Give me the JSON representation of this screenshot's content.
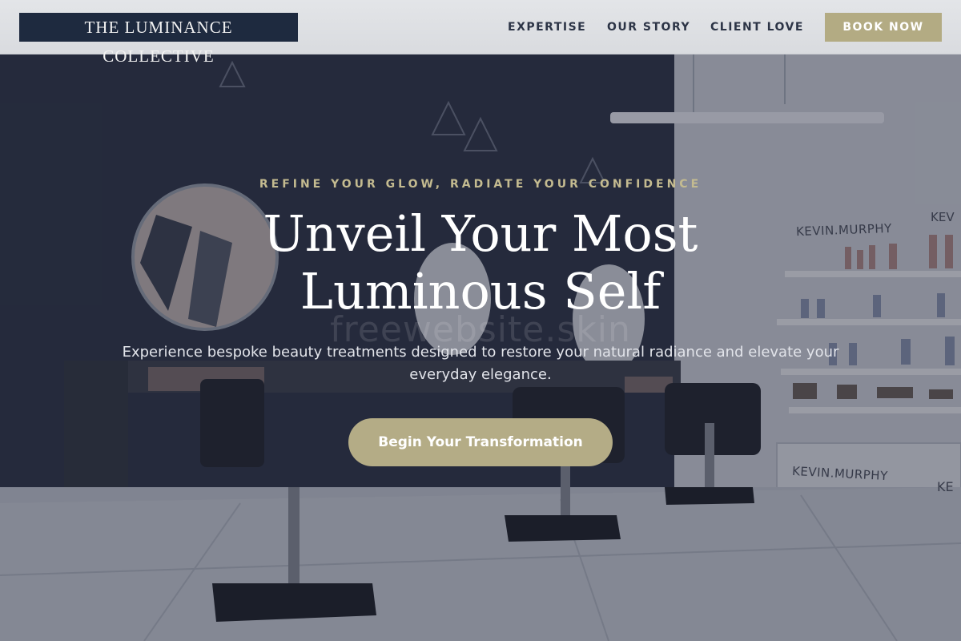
{
  "brand": {
    "name": "THE LUMINANCE COLLECTIVE"
  },
  "nav": {
    "items": [
      {
        "label": "EXPERTISE"
      },
      {
        "label": "OUR STORY"
      },
      {
        "label": "CLIENT LOVE"
      }
    ],
    "cta_label": "BOOK NOW"
  },
  "hero": {
    "tagline": "REFINE YOUR GLOW, RADIATE YOUR CONFIDENCE",
    "headline_line1": "Unveil Your Most",
    "headline_line2": "Luminous Self",
    "subtext": "Experience bespoke beauty treatments designed to restore your natural radiance and elevate your everyday elegance.",
    "cta_label": "Begin Your Transformation",
    "watermark": "freewebsite.skin",
    "shelf_signs": [
      "KEVIN.MURPHY",
      "KEVIN.MURPHY",
      "KEV",
      "KE"
    ]
  },
  "colors": {
    "navy": "#1e2a3f",
    "gold": "#b3ab83",
    "tagline_gold": "#c4bb90"
  }
}
